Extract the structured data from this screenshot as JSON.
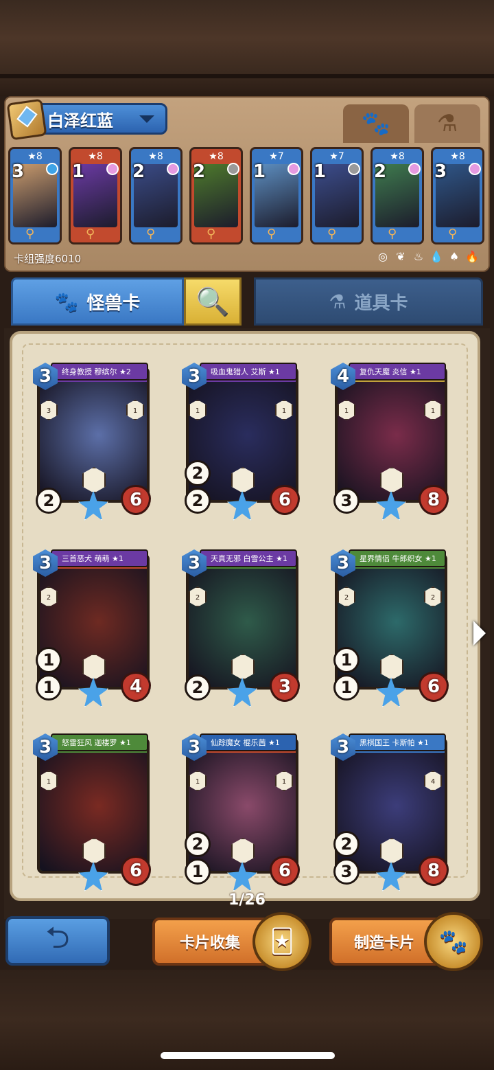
{
  "deck": {
    "name": "白泽红蓝",
    "power_label": "卡组强度6010",
    "tabs": [
      {
        "icon": "paw-icon",
        "glyph": "🐾",
        "active": true
      },
      {
        "icon": "potion-icon",
        "glyph": "⚗",
        "active": false
      }
    ],
    "elements": [
      "◎",
      "❦",
      "♨",
      "💧",
      "♠",
      "🔥"
    ],
    "cards": [
      {
        "stars": "★8",
        "cost": "3",
        "color": "#3a78c4",
        "art": "#c99b6d",
        "gem": "#3fa3e6"
      },
      {
        "stars": "★8",
        "cost": "1",
        "color": "#c24a2e",
        "art": "#6b3aa3",
        "gem": "#e59ae0"
      },
      {
        "stars": "★8",
        "cost": "2",
        "color": "#3a78c4",
        "art": "#3a4b86",
        "gem": "#e59ae0"
      },
      {
        "stars": "★8",
        "cost": "2",
        "color": "#c24a2e",
        "art": "#4e7a2c",
        "gem": "#9a9a9a"
      },
      {
        "stars": "★7",
        "cost": "1",
        "color": "#3a78c4",
        "art": "#5d8ec0",
        "gem": "#e59ae0"
      },
      {
        "stars": "★7",
        "cost": "1",
        "color": "#3a78c4",
        "art": "#3c4d8c",
        "gem": "#9a9a9a"
      },
      {
        "stars": "★8",
        "cost": "2",
        "color": "#3a78c4",
        "art": "#3f7b4e",
        "gem": "#e59ae0"
      },
      {
        "stars": "★8",
        "cost": "3",
        "color": "#3a78c4",
        "art": "#2f5688",
        "gem": "#e59ae0"
      }
    ]
  },
  "categories": {
    "monster_label": "怪兽卡",
    "item_label": "道具卡",
    "search_icon": "search-icon"
  },
  "collection": {
    "page": "1/26",
    "cards": [
      {
        "name": "终身教授 穆缤尔 ★2",
        "cost": "3",
        "attack": "2",
        "health": "6",
        "mid": "",
        "left_small": "3",
        "right_small": "1",
        "bar": "#6b3aa3",
        "art": "#5c6fa8",
        "border": "#6b3aa3"
      },
      {
        "name": "吸血鬼猎人 艾斯 ★1",
        "cost": "3",
        "attack": "2",
        "health": "6",
        "mid": "2",
        "left_small": "1",
        "right_small": "1",
        "bar": "#6b3aa3",
        "art": "#2a2d5e",
        "border": "#6b3aa3"
      },
      {
        "name": "复仇天魔 炎信 ★1",
        "cost": "4",
        "attack": "3",
        "health": "8",
        "mid": "",
        "left_small": "1",
        "right_small": "1",
        "bar": "#6b3aa3",
        "art": "#7a2c4a",
        "border": "#c2a13c"
      },
      {
        "name": "三首恶犬 萌萌 ★1",
        "cost": "3",
        "attack": "1",
        "health": "4",
        "mid": "1",
        "left_small": "2",
        "right_small": "",
        "bar": "#6b3aa3",
        "art": "#6e2a22",
        "border": "#c24a2e"
      },
      {
        "name": "天真无邪 白雪公主 ★1",
        "cost": "3",
        "attack": "2",
        "health": "3",
        "mid": "",
        "left_small": "2",
        "right_small": "",
        "bar": "#6b3aa3",
        "art": "#2f5b4a",
        "border": "#4e8a3a"
      },
      {
        "name": "星界情侣 牛郎织女 ★1",
        "cost": "3",
        "attack": "1",
        "health": "6",
        "mid": "1",
        "left_small": "2",
        "right_small": "2",
        "bar": "#4e8a3a",
        "art": "#2d6a6a",
        "border": "#4e8a3a"
      },
      {
        "name": "怒雷狂风 迦楼罗 ★1",
        "cost": "3",
        "attack": "",
        "health": "6",
        "mid": "",
        "left_small": "1",
        "right_small": "",
        "bar": "#4e8a3a",
        "art": "#7a2a22",
        "border": "#4e8a3a"
      },
      {
        "name": "仙踪魔女 棍乐茜 ★1",
        "cost": "3",
        "attack": "1",
        "health": "6",
        "mid": "2",
        "left_small": "1",
        "right_small": "1",
        "bar": "#2c63b0",
        "art": "#8a4a6a",
        "border": "#c24a2e"
      },
      {
        "name": "黑棋国王 卡斯帕 ★1",
        "cost": "3",
        "attack": "3",
        "health": "8",
        "mid": "2",
        "left_small": "",
        "right_small": "4",
        "bar": "#3a78c4",
        "art": "#3c3d7a",
        "border": "#3a78c4"
      }
    ]
  },
  "buttons": {
    "back_glyph": "⮌",
    "collect_label": "卡片收集",
    "craft_label": "制造卡片",
    "collect_medal": "🃏",
    "craft_medal": "🐾"
  }
}
